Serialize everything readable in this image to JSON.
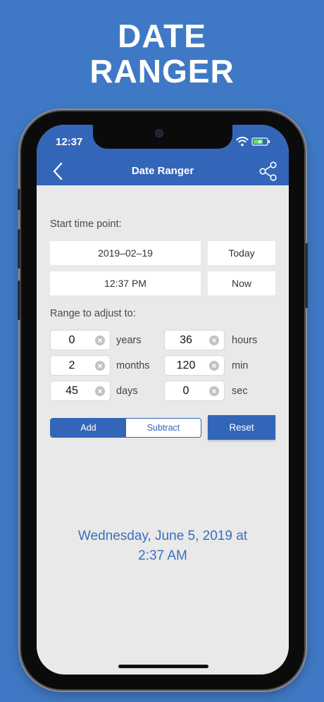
{
  "promo": {
    "title_line1": "DATE",
    "title_line2": "RANGER"
  },
  "status_bar": {
    "time": "12:37"
  },
  "nav": {
    "title": "Date Ranger"
  },
  "start": {
    "label": "Start time point:",
    "date_value": "2019–02–19",
    "today_label": "Today",
    "time_value": "12:37 PM",
    "now_label": "Now"
  },
  "range": {
    "label": "Range to adjust to:",
    "fields": {
      "years": {
        "value": "0",
        "unit": "years"
      },
      "months": {
        "value": "2",
        "unit": "months"
      },
      "days": {
        "value": "45",
        "unit": "days"
      },
      "hours": {
        "value": "36",
        "unit": "hours"
      },
      "min": {
        "value": "120",
        "unit": "min"
      },
      "sec": {
        "value": "0",
        "unit": "sec"
      }
    }
  },
  "actions": {
    "add_label": "Add",
    "subtract_label": "Subtract",
    "selected": "Add",
    "reset_label": "Reset"
  },
  "result": {
    "line1": "Wednesday, June 5, 2019 at",
    "line2": "2:37 AM"
  },
  "colors": {
    "background": "#3f79c5",
    "accent": "#3366b8",
    "result_text": "#3a6fbd",
    "screen_bg": "#e9e9e9"
  },
  "icons": {
    "back": "chevron-left-icon",
    "share": "share-icon",
    "clear": "clear-circle-icon",
    "wifi": "wifi-icon",
    "battery": "battery-charging-icon"
  }
}
